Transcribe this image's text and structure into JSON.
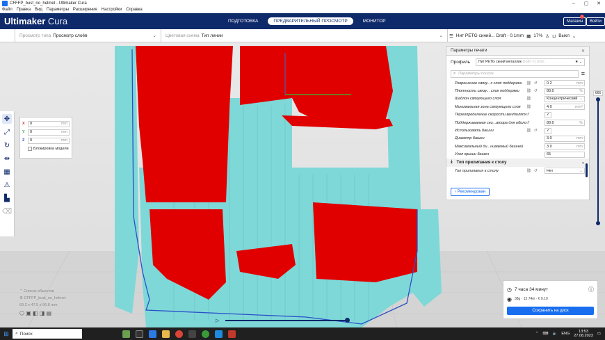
{
  "window": {
    "title": "CFFFP_bust_no_helmet - Ultimaker Cura"
  },
  "menu": [
    "Файл",
    "Правка",
    "Вид",
    "Параметры",
    "Расширения",
    "Настройки",
    "Справка"
  ],
  "header": {
    "brand_bold": "Ultimaker",
    "brand_light": "Cura",
    "stages": [
      "ПОДГОТОВКА",
      "ПРЕДВАРИТЕЛЬНЫЙ ПРОСМОТР",
      "МОНИТОР"
    ],
    "active_stage": 1,
    "marketplace": "Магазин",
    "marketplace_badge": "2",
    "signin": "Войти"
  },
  "toolbar": {
    "view_type_label": "Просмотр типа",
    "view_type_value": "Просмотр слоёв",
    "color_scheme_label": "Цветовая схема",
    "color_scheme_value": "Тип линии",
    "material": "Нит PETG синий... Draft - 0.1mm",
    "infill": "17%",
    "adhesion": "Выкл"
  },
  "move_panel": {
    "x": "0",
    "y": "0",
    "z": "0",
    "unit": "mm",
    "lock_label": "Блокировка модели"
  },
  "settings": {
    "title": "Параметры печати",
    "profile_label": "Профиль",
    "profile_value": "Нит PETG синий металлик",
    "profile_suffix": "Draft - 0.1mm",
    "search_placeholder": "Параметры поиска",
    "rows": [
      {
        "name": "Разрешение связу...х слоя поддержки",
        "value": "0.2",
        "unit": "mm"
      },
      {
        "name": "Плотность связу... слоя поддержки",
        "value": "80.0",
        "unit": "%"
      },
      {
        "name": "Шаблон связующего слоя",
        "value": "Концентрический",
        "unit": ""
      },
      {
        "name": "Минимальная зона связующего слоя",
        "value": "4.0",
        "unit": "mm²"
      },
      {
        "name": "Переопределение скорости вентилятора",
        "value": "✓",
        "unit": ""
      },
      {
        "name": "Поддерживаемая ско...атора для оболочки",
        "value": "80.0",
        "unit": "%"
      },
      {
        "name": "Использовать башни",
        "value": "✓",
        "unit": ""
      },
      {
        "name": "Диаметр башен",
        "value": "3.0",
        "unit": "mm"
      },
      {
        "name": "Максимальный ди...ниваемый башней",
        "value": "3.0",
        "unit": "mm"
      },
      {
        "name": "Угол крыши башен",
        "value": "65",
        "unit": ""
      }
    ],
    "category": "Тип прилипания к столу",
    "adhesion_row": {
      "name": "Тип прилипания к столу",
      "value": "Нет"
    },
    "recommended_button": "Рекомендован"
  },
  "layer_view": {
    "current_layer": "666",
    "layer_fraction": 0.0
  },
  "objects": {
    "header": "Список объектов",
    "item": "CFFFP_bust_no_helmet",
    "dims": "69.2 x 47.5 x 96.8 mm"
  },
  "print_info": {
    "time": "7 часа 34 минут",
    "material": "38g · 12.74m · € 0.19",
    "save_button": "Сохранить на диск"
  },
  "taskbar": {
    "search": "Поиск",
    "lang": "ENG",
    "time": "13:53",
    "date": "27.08.2023"
  },
  "colors": {
    "accent": "#196ef0",
    "header": "#0f2a6b",
    "wall": "#e00000",
    "support": "#7fd8d8"
  }
}
